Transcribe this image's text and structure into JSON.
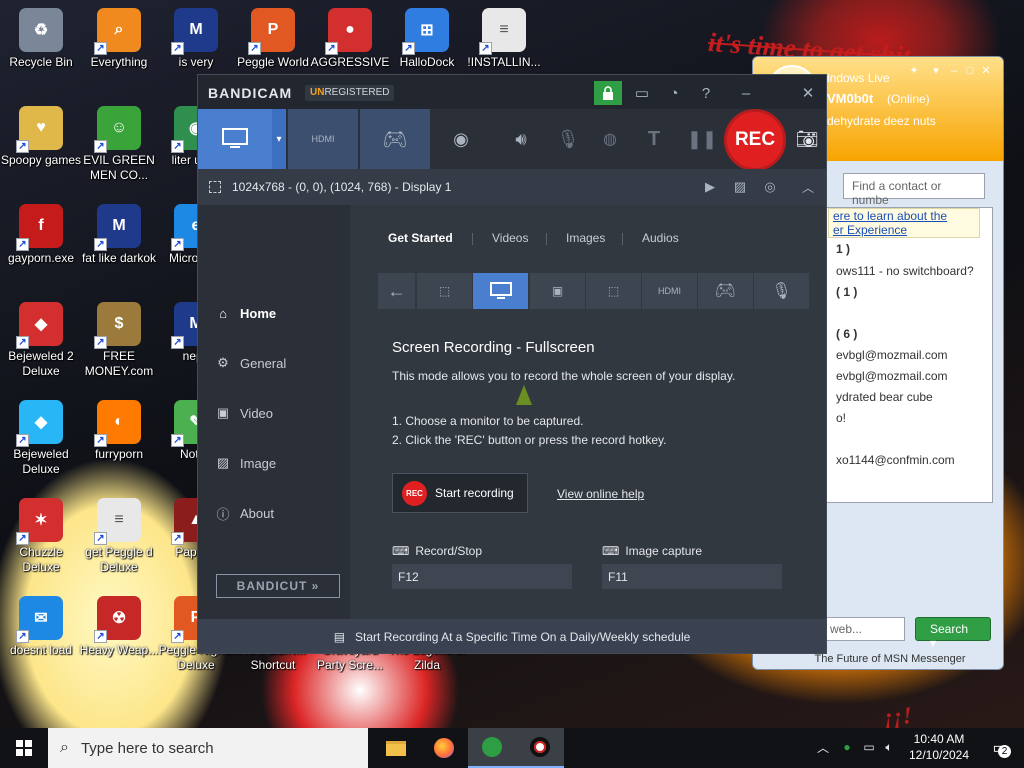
{
  "wallpaper": {
    "caption": "it's time to get shit",
    "corner_mark": "¡¡!"
  },
  "desktop_icons": [
    {
      "label": "Recycle Bin",
      "color": "#7a8799",
      "glyph": "♻"
    },
    {
      "label": "Everything",
      "color": "#f08a1e",
      "glyph": "⌕"
    },
    {
      "label": "is very",
      "color": "#1f3a8a",
      "glyph": "M"
    },
    {
      "label": "Peggle World",
      "color": "#e25822",
      "glyph": "P"
    },
    {
      "label": "AGGRESSIVE",
      "color": "#d32f2f",
      "glyph": "●"
    },
    {
      "label": "HalloDock",
      "color": "#2f7de1",
      "glyph": "⊞"
    },
    {
      "label": "!INSTALLIN...",
      "color": "#e8e8e8",
      "glyph": "≡"
    },
    {
      "label": "Spoopy games",
      "color": "#e0b84a",
      "glyph": "♥"
    },
    {
      "label": "EVIL GREEN MEN CO...",
      "color": "#3aa33a",
      "glyph": "☺"
    },
    {
      "label": "liter unus",
      "color": "#2f8f4e",
      "glyph": "◉"
    },
    {
      "label": "gayporn.exe",
      "color": "#c61b1b",
      "glyph": "f"
    },
    {
      "label": "fat like darkok",
      "color": "#1f3a8a",
      "glyph": "M"
    },
    {
      "label": "Micro Edg",
      "color": "#1e88e5",
      "glyph": "e"
    },
    {
      "label": "Bejeweled 2 Deluxe",
      "color": "#d32f2f",
      "glyph": "◆"
    },
    {
      "label": "FREE MONEY.com",
      "color": "#9c7a3c",
      "glyph": "$"
    },
    {
      "label": "neph",
      "color": "#1f3a8a",
      "glyph": "M"
    },
    {
      "label": "Bejeweled Deluxe",
      "color": "#29b6f6",
      "glyph": "◆"
    },
    {
      "label": "furryporn",
      "color": "#ff7a00",
      "glyph": "◐"
    },
    {
      "label": "Notep",
      "color": "#4caf50",
      "glyph": "✎"
    },
    {
      "label": "Chuzzle Deluxe",
      "color": "#d32f2f",
      "glyph": "✶"
    },
    {
      "label": "get Peggle d Deluxe",
      "color": "#e8e8e8",
      "glyph": "≡"
    },
    {
      "label": "Papers,",
      "color": "#8b1d1d",
      "glyph": "▲"
    },
    {
      "label": "doesnt load",
      "color": "#1e88e5",
      "glyph": "✉"
    },
    {
      "label": "Heavy Weap...",
      "color": "#c62828",
      "glyph": "☢"
    },
    {
      "label": "Peggle Nights Deluxe",
      "color": "#e25822",
      "glyph": "P"
    },
    {
      "label": "!INSTALLIN... - Shortcut",
      "color": "#e8e8e8",
      "glyph": "≡"
    },
    {
      "label": "Graveyard Party Scre...",
      "color": "#6d4c41",
      "glyph": "☠"
    },
    {
      "label": "The Legend of Zilda",
      "color": "#2e7d32",
      "glyph": "△"
    }
  ],
  "msn": {
    "title": "indows Live",
    "name": "VM0b0t",
    "status": "(Online)",
    "message": "dehydrate deez nuts",
    "search_placeholder": "Find a contact or numbe",
    "info_line1": "ere to learn about the",
    "info_line2": "er Experience",
    "rows": [
      "1 )",
      "ows111 - no switchboard?",
      "( 1 )",
      "( 6 )",
      "evbgl@mozmail.com",
      "evbgl@mozmail.com",
      "ydrated bear cube",
      "o!",
      "xo1144@confmin.com"
    ],
    "web_placeholder": "web...",
    "search_button": "Search",
    "footer": "The Future of MSN Messenger"
  },
  "bandicam": {
    "logo": "BANDICAM",
    "unreg_prefix": "UN",
    "unreg_rest": "REGISTERED",
    "rec_label": "REC",
    "display_info": "1024x768 - (0, 0), (1024, 768) - Display 1",
    "nav": [
      "Home",
      "General",
      "Video",
      "Image",
      "About"
    ],
    "bandicut": "BANDICUT »",
    "tabs": [
      "Get Started",
      "Videos",
      "Images",
      "Audios"
    ],
    "mode_title": "Screen Recording - Fullscreen",
    "mode_desc": "This mode allows you to record the whole screen of your display.",
    "step1": "1. Choose a monitor to be captured.",
    "step2": "2. Click the 'REC' button or press the record hotkey.",
    "start_button": "Start recording",
    "start_icon_label": "REC",
    "help_link": "View online help",
    "record_stop_label": "Record/Stop",
    "record_stop_key": "F12",
    "image_capture_label": "Image capture",
    "image_capture_key": "F11",
    "footer": "Start Recording At a Specific Time On a Daily/Weekly schedule"
  },
  "taskbar": {
    "search_placeholder": "Type here to search",
    "time": "10:40 AM",
    "date": "12/10/2024",
    "notification_count": "2"
  }
}
